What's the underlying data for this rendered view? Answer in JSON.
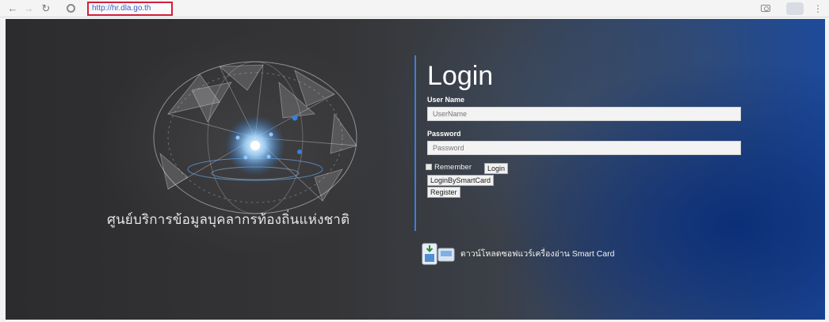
{
  "browser": {
    "url": "http://hr.dla.go.th"
  },
  "page": {
    "brand_text": "ศูนย์บริการข้อมูลบุคลากรท้องถิ่นแห่งชาติ",
    "login": {
      "title": "Login",
      "username_label": "User Name",
      "username_placeholder": "UserName",
      "password_label": "Password",
      "password_placeholder": "Password",
      "remember_label": "Remember",
      "login_button": "Login",
      "smartcard_button": "LoginBySmartCard",
      "register_button": "Register"
    },
    "download": {
      "label": "ดาวน์โหลดซอฟแวร์เครื่องอ่าน Smart Card",
      "icon": "download-software-icon"
    },
    "colors": {
      "divider": "#3f7fd8",
      "url_highlight": "#d21f3a"
    }
  }
}
